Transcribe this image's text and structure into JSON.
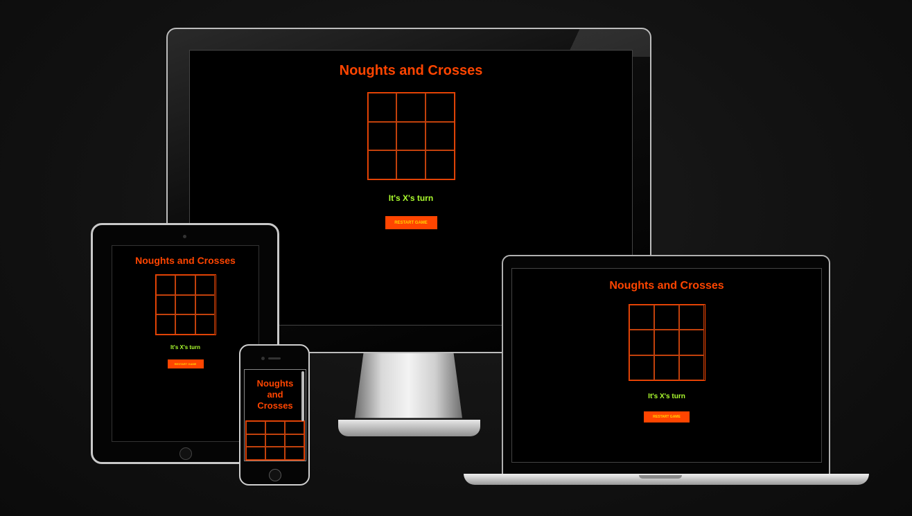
{
  "app": {
    "title": "Noughts and Crosses",
    "status": "It's X's turn",
    "restart_label": "RESTART GAME",
    "board": [
      "",
      "",
      "",
      "",
      "",
      "",
      "",
      "",
      ""
    ]
  },
  "colors": {
    "accent": "#ff4500",
    "status": "#adff2f",
    "button_text": "#ffd700",
    "background": "#000000"
  },
  "devices": [
    "desktop-monitor",
    "tablet",
    "phone",
    "laptop"
  ]
}
